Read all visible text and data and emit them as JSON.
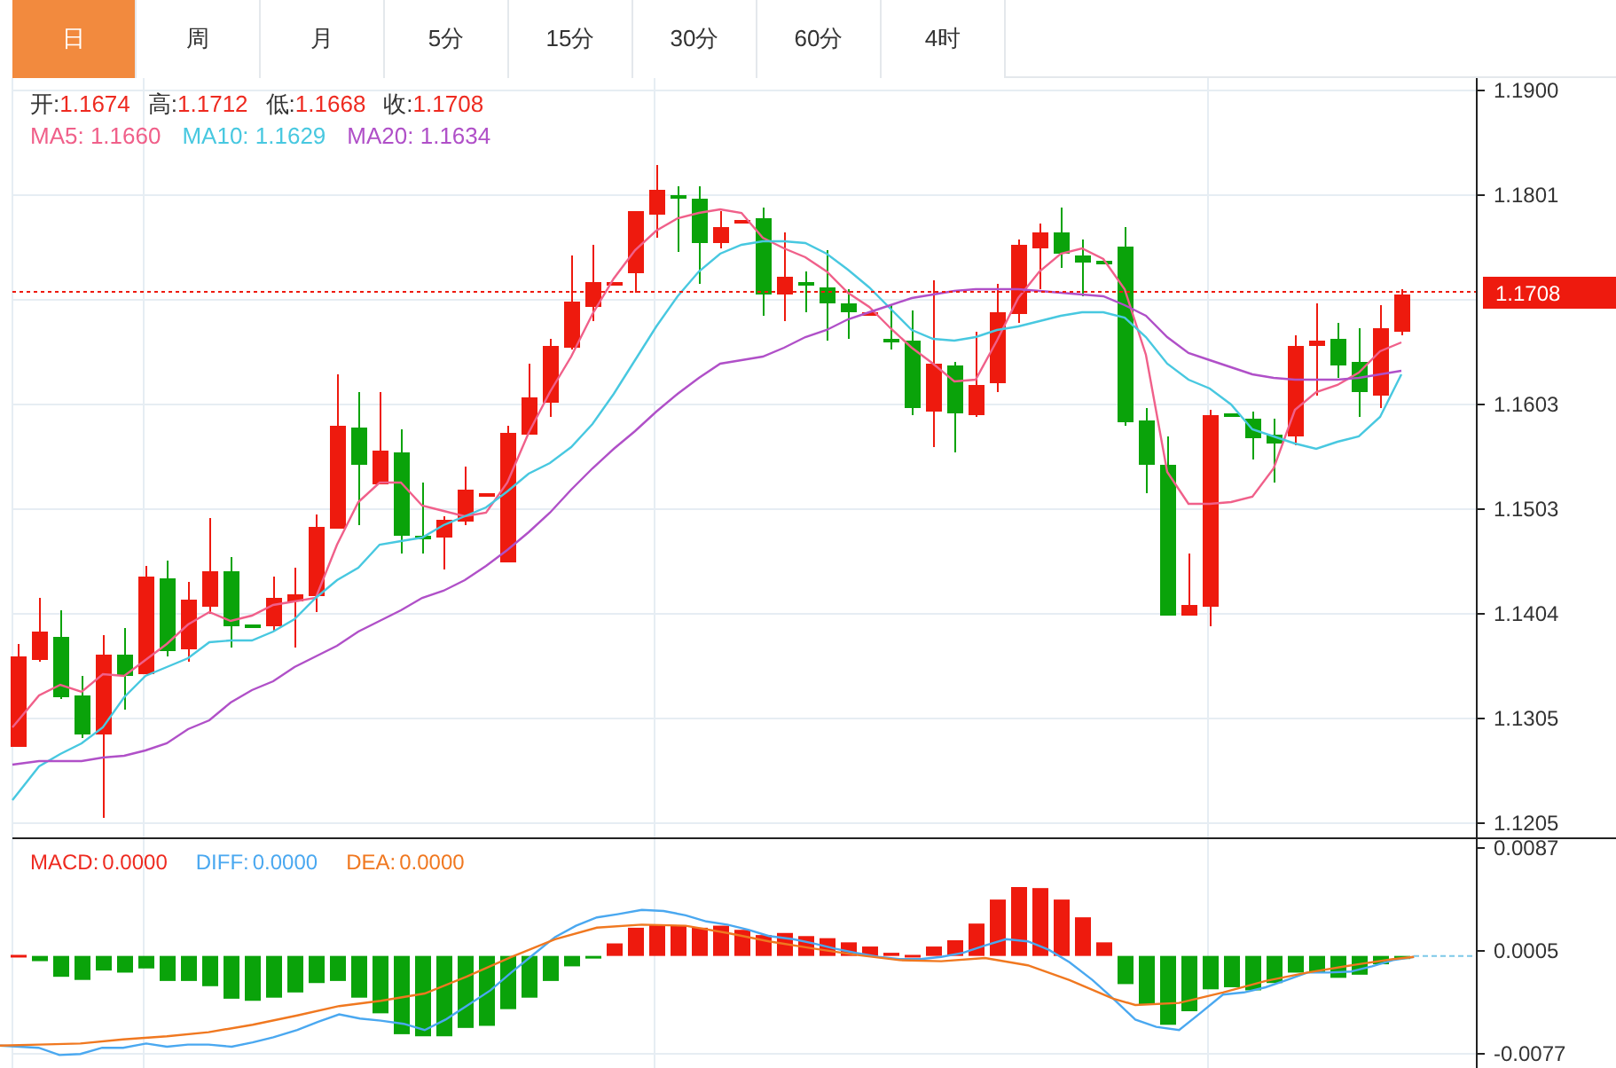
{
  "tabs": [
    {
      "label": "日",
      "selected": true
    },
    {
      "label": "周",
      "selected": false
    },
    {
      "label": "月",
      "selected": false
    },
    {
      "label": "5分",
      "selected": false
    },
    {
      "label": "15分",
      "selected": false
    },
    {
      "label": "30分",
      "selected": false
    },
    {
      "label": "60分",
      "selected": false
    },
    {
      "label": "4时",
      "selected": false
    }
  ],
  "quote": [
    {
      "label": "开:",
      "value": "1.1674"
    },
    {
      "label": "高:",
      "value": "1.1712"
    },
    {
      "label": "低:",
      "value": "1.1668"
    },
    {
      "label": "收:",
      "value": "1.1708"
    }
  ],
  "moving_averages": [
    {
      "label": "MA5:",
      "value": "1.1660",
      "color": "#f0608a"
    },
    {
      "label": "MA10:",
      "value": "1.1629",
      "color": "#48c8e0"
    },
    {
      "label": "MA20:",
      "value": "1.1634",
      "color": "#b050c8"
    }
  ],
  "price_axis": {
    "ticks": [
      "1.1900",
      "1.1801",
      "1.1603",
      "1.1503",
      "1.1404",
      "1.1305",
      "1.1205"
    ],
    "current_price": "1.1708"
  },
  "macd_legend": [
    {
      "label": "MACD:",
      "value": "0.0000",
      "color": "#ee2a20"
    },
    {
      "label": "DIFF:",
      "value": "0.0000",
      "color": "#4aa8f0"
    },
    {
      "label": "DEA:",
      "value": "0.0000",
      "color": "#f07820"
    }
  ],
  "macd_axis": [
    "0.0087",
    "0.0005",
    "-0.0077"
  ]
}
